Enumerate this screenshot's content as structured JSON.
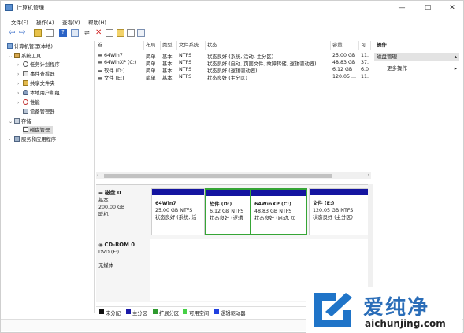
{
  "window": {
    "title": "计算机管理"
  },
  "menu": [
    "文件(F)",
    "操作(A)",
    "查看(V)",
    "帮助(H)"
  ],
  "tree": [
    {
      "label": "计算机管理(本地)"
    },
    {
      "label": "系统工具"
    },
    {
      "label": "任务计划程序"
    },
    {
      "label": "事件查看器"
    },
    {
      "label": "共享文件夹"
    },
    {
      "label": "本地用户和组"
    },
    {
      "label": "性能"
    },
    {
      "label": "设备管理器"
    },
    {
      "label": "存储"
    },
    {
      "label": "磁盘管理"
    },
    {
      "label": "服务和应用程序"
    }
  ],
  "volume_table": {
    "headers": [
      "卷",
      "布局",
      "类型",
      "文件系统",
      "状态",
      "容量",
      "可"
    ],
    "rows": [
      {
        "name": "64Win7",
        "layout": "简单",
        "type": "基本",
        "fs": "NTFS",
        "status": "状态良好 (系统, 活动, 主分区)",
        "capacity": "25.00 GB",
        "free": "11."
      },
      {
        "name": "64WinXP  (C:)",
        "layout": "简单",
        "type": "基本",
        "fs": "NTFS",
        "status": "状态良好 (启动, 页面文件, 故障转储, 逻辑驱动器)",
        "capacity": "48.83 GB",
        "free": "37."
      },
      {
        "name": "软件 (D:)",
        "layout": "简单",
        "type": "基本",
        "fs": "NTFS",
        "status": "状态良好 (逻辑驱动器)",
        "capacity": "6.12 GB",
        "free": "6.0"
      },
      {
        "name": "文件 (E:)",
        "layout": "简单",
        "type": "基本",
        "fs": "NTFS",
        "status": "状态良好 (主分区)",
        "capacity": "120.05 ...",
        "free": "11."
      }
    ]
  },
  "disk0": {
    "name": "磁盘 0",
    "type": "基本",
    "size": "200.00 GB",
    "state": "联机",
    "partitions": [
      {
        "name": "64Win7",
        "size": "25.00 GB NTFS",
        "status": "状态良好 (系统, 活"
      },
      {
        "name": "软件  (D:)",
        "size": "6.12 GB NTFS",
        "status": "状态良好 (逻辑"
      },
      {
        "name": "64WinXP  (C:)",
        "size": "48.83 GB NTFS",
        "status": "状态良好 (启动, 页"
      },
      {
        "name": "文件  (E:)",
        "size": "120.05 GB NTFS",
        "status": "状态良好 (主分区)"
      }
    ]
  },
  "cdrom": {
    "name": "CD-ROM 0",
    "drive": "DVD (F:)",
    "media": "无媒体"
  },
  "legend": [
    {
      "label": "未分配",
      "color": "#111111"
    },
    {
      "label": "主分区",
      "color": "#1a1aa8"
    },
    {
      "label": "扩展分区",
      "color": "#2f9a2f"
    },
    {
      "label": "可用空间",
      "color": "#46d046"
    },
    {
      "label": "逻辑驱动器",
      "color": "#2040e0"
    }
  ],
  "actions": {
    "header": "操作",
    "section": "磁盘管理",
    "more": "更多操作"
  },
  "watermark": {
    "brand": "爱纯净",
    "url": "aichunjing.com"
  }
}
